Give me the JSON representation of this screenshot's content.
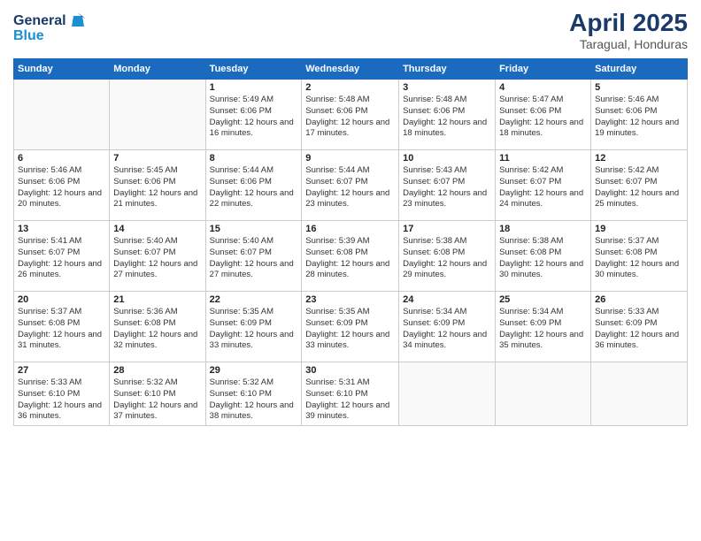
{
  "logo": {
    "line1": "General",
    "line2": "Blue"
  },
  "title": "April 2025",
  "location": "Taragual, Honduras",
  "days_of_week": [
    "Sunday",
    "Monday",
    "Tuesday",
    "Wednesday",
    "Thursday",
    "Friday",
    "Saturday"
  ],
  "weeks": [
    [
      {
        "day": "",
        "info": ""
      },
      {
        "day": "",
        "info": ""
      },
      {
        "day": "1",
        "info": "Sunrise: 5:49 AM\nSunset: 6:06 PM\nDaylight: 12 hours\nand 16 minutes."
      },
      {
        "day": "2",
        "info": "Sunrise: 5:48 AM\nSunset: 6:06 PM\nDaylight: 12 hours\nand 17 minutes."
      },
      {
        "day": "3",
        "info": "Sunrise: 5:48 AM\nSunset: 6:06 PM\nDaylight: 12 hours\nand 18 minutes."
      },
      {
        "day": "4",
        "info": "Sunrise: 5:47 AM\nSunset: 6:06 PM\nDaylight: 12 hours\nand 18 minutes."
      },
      {
        "day": "5",
        "info": "Sunrise: 5:46 AM\nSunset: 6:06 PM\nDaylight: 12 hours\nand 19 minutes."
      }
    ],
    [
      {
        "day": "6",
        "info": "Sunrise: 5:46 AM\nSunset: 6:06 PM\nDaylight: 12 hours\nand 20 minutes."
      },
      {
        "day": "7",
        "info": "Sunrise: 5:45 AM\nSunset: 6:06 PM\nDaylight: 12 hours\nand 21 minutes."
      },
      {
        "day": "8",
        "info": "Sunrise: 5:44 AM\nSunset: 6:06 PM\nDaylight: 12 hours\nand 22 minutes."
      },
      {
        "day": "9",
        "info": "Sunrise: 5:44 AM\nSunset: 6:07 PM\nDaylight: 12 hours\nand 23 minutes."
      },
      {
        "day": "10",
        "info": "Sunrise: 5:43 AM\nSunset: 6:07 PM\nDaylight: 12 hours\nand 23 minutes."
      },
      {
        "day": "11",
        "info": "Sunrise: 5:42 AM\nSunset: 6:07 PM\nDaylight: 12 hours\nand 24 minutes."
      },
      {
        "day": "12",
        "info": "Sunrise: 5:42 AM\nSunset: 6:07 PM\nDaylight: 12 hours\nand 25 minutes."
      }
    ],
    [
      {
        "day": "13",
        "info": "Sunrise: 5:41 AM\nSunset: 6:07 PM\nDaylight: 12 hours\nand 26 minutes."
      },
      {
        "day": "14",
        "info": "Sunrise: 5:40 AM\nSunset: 6:07 PM\nDaylight: 12 hours\nand 27 minutes."
      },
      {
        "day": "15",
        "info": "Sunrise: 5:40 AM\nSunset: 6:07 PM\nDaylight: 12 hours\nand 27 minutes."
      },
      {
        "day": "16",
        "info": "Sunrise: 5:39 AM\nSunset: 6:08 PM\nDaylight: 12 hours\nand 28 minutes."
      },
      {
        "day": "17",
        "info": "Sunrise: 5:38 AM\nSunset: 6:08 PM\nDaylight: 12 hours\nand 29 minutes."
      },
      {
        "day": "18",
        "info": "Sunrise: 5:38 AM\nSunset: 6:08 PM\nDaylight: 12 hours\nand 30 minutes."
      },
      {
        "day": "19",
        "info": "Sunrise: 5:37 AM\nSunset: 6:08 PM\nDaylight: 12 hours\nand 30 minutes."
      }
    ],
    [
      {
        "day": "20",
        "info": "Sunrise: 5:37 AM\nSunset: 6:08 PM\nDaylight: 12 hours\nand 31 minutes."
      },
      {
        "day": "21",
        "info": "Sunrise: 5:36 AM\nSunset: 6:08 PM\nDaylight: 12 hours\nand 32 minutes."
      },
      {
        "day": "22",
        "info": "Sunrise: 5:35 AM\nSunset: 6:09 PM\nDaylight: 12 hours\nand 33 minutes."
      },
      {
        "day": "23",
        "info": "Sunrise: 5:35 AM\nSunset: 6:09 PM\nDaylight: 12 hours\nand 33 minutes."
      },
      {
        "day": "24",
        "info": "Sunrise: 5:34 AM\nSunset: 6:09 PM\nDaylight: 12 hours\nand 34 minutes."
      },
      {
        "day": "25",
        "info": "Sunrise: 5:34 AM\nSunset: 6:09 PM\nDaylight: 12 hours\nand 35 minutes."
      },
      {
        "day": "26",
        "info": "Sunrise: 5:33 AM\nSunset: 6:09 PM\nDaylight: 12 hours\nand 36 minutes."
      }
    ],
    [
      {
        "day": "27",
        "info": "Sunrise: 5:33 AM\nSunset: 6:10 PM\nDaylight: 12 hours\nand 36 minutes."
      },
      {
        "day": "28",
        "info": "Sunrise: 5:32 AM\nSunset: 6:10 PM\nDaylight: 12 hours\nand 37 minutes."
      },
      {
        "day": "29",
        "info": "Sunrise: 5:32 AM\nSunset: 6:10 PM\nDaylight: 12 hours\nand 38 minutes."
      },
      {
        "day": "30",
        "info": "Sunrise: 5:31 AM\nSunset: 6:10 PM\nDaylight: 12 hours\nand 39 minutes."
      },
      {
        "day": "",
        "info": ""
      },
      {
        "day": "",
        "info": ""
      },
      {
        "day": "",
        "info": ""
      }
    ]
  ]
}
